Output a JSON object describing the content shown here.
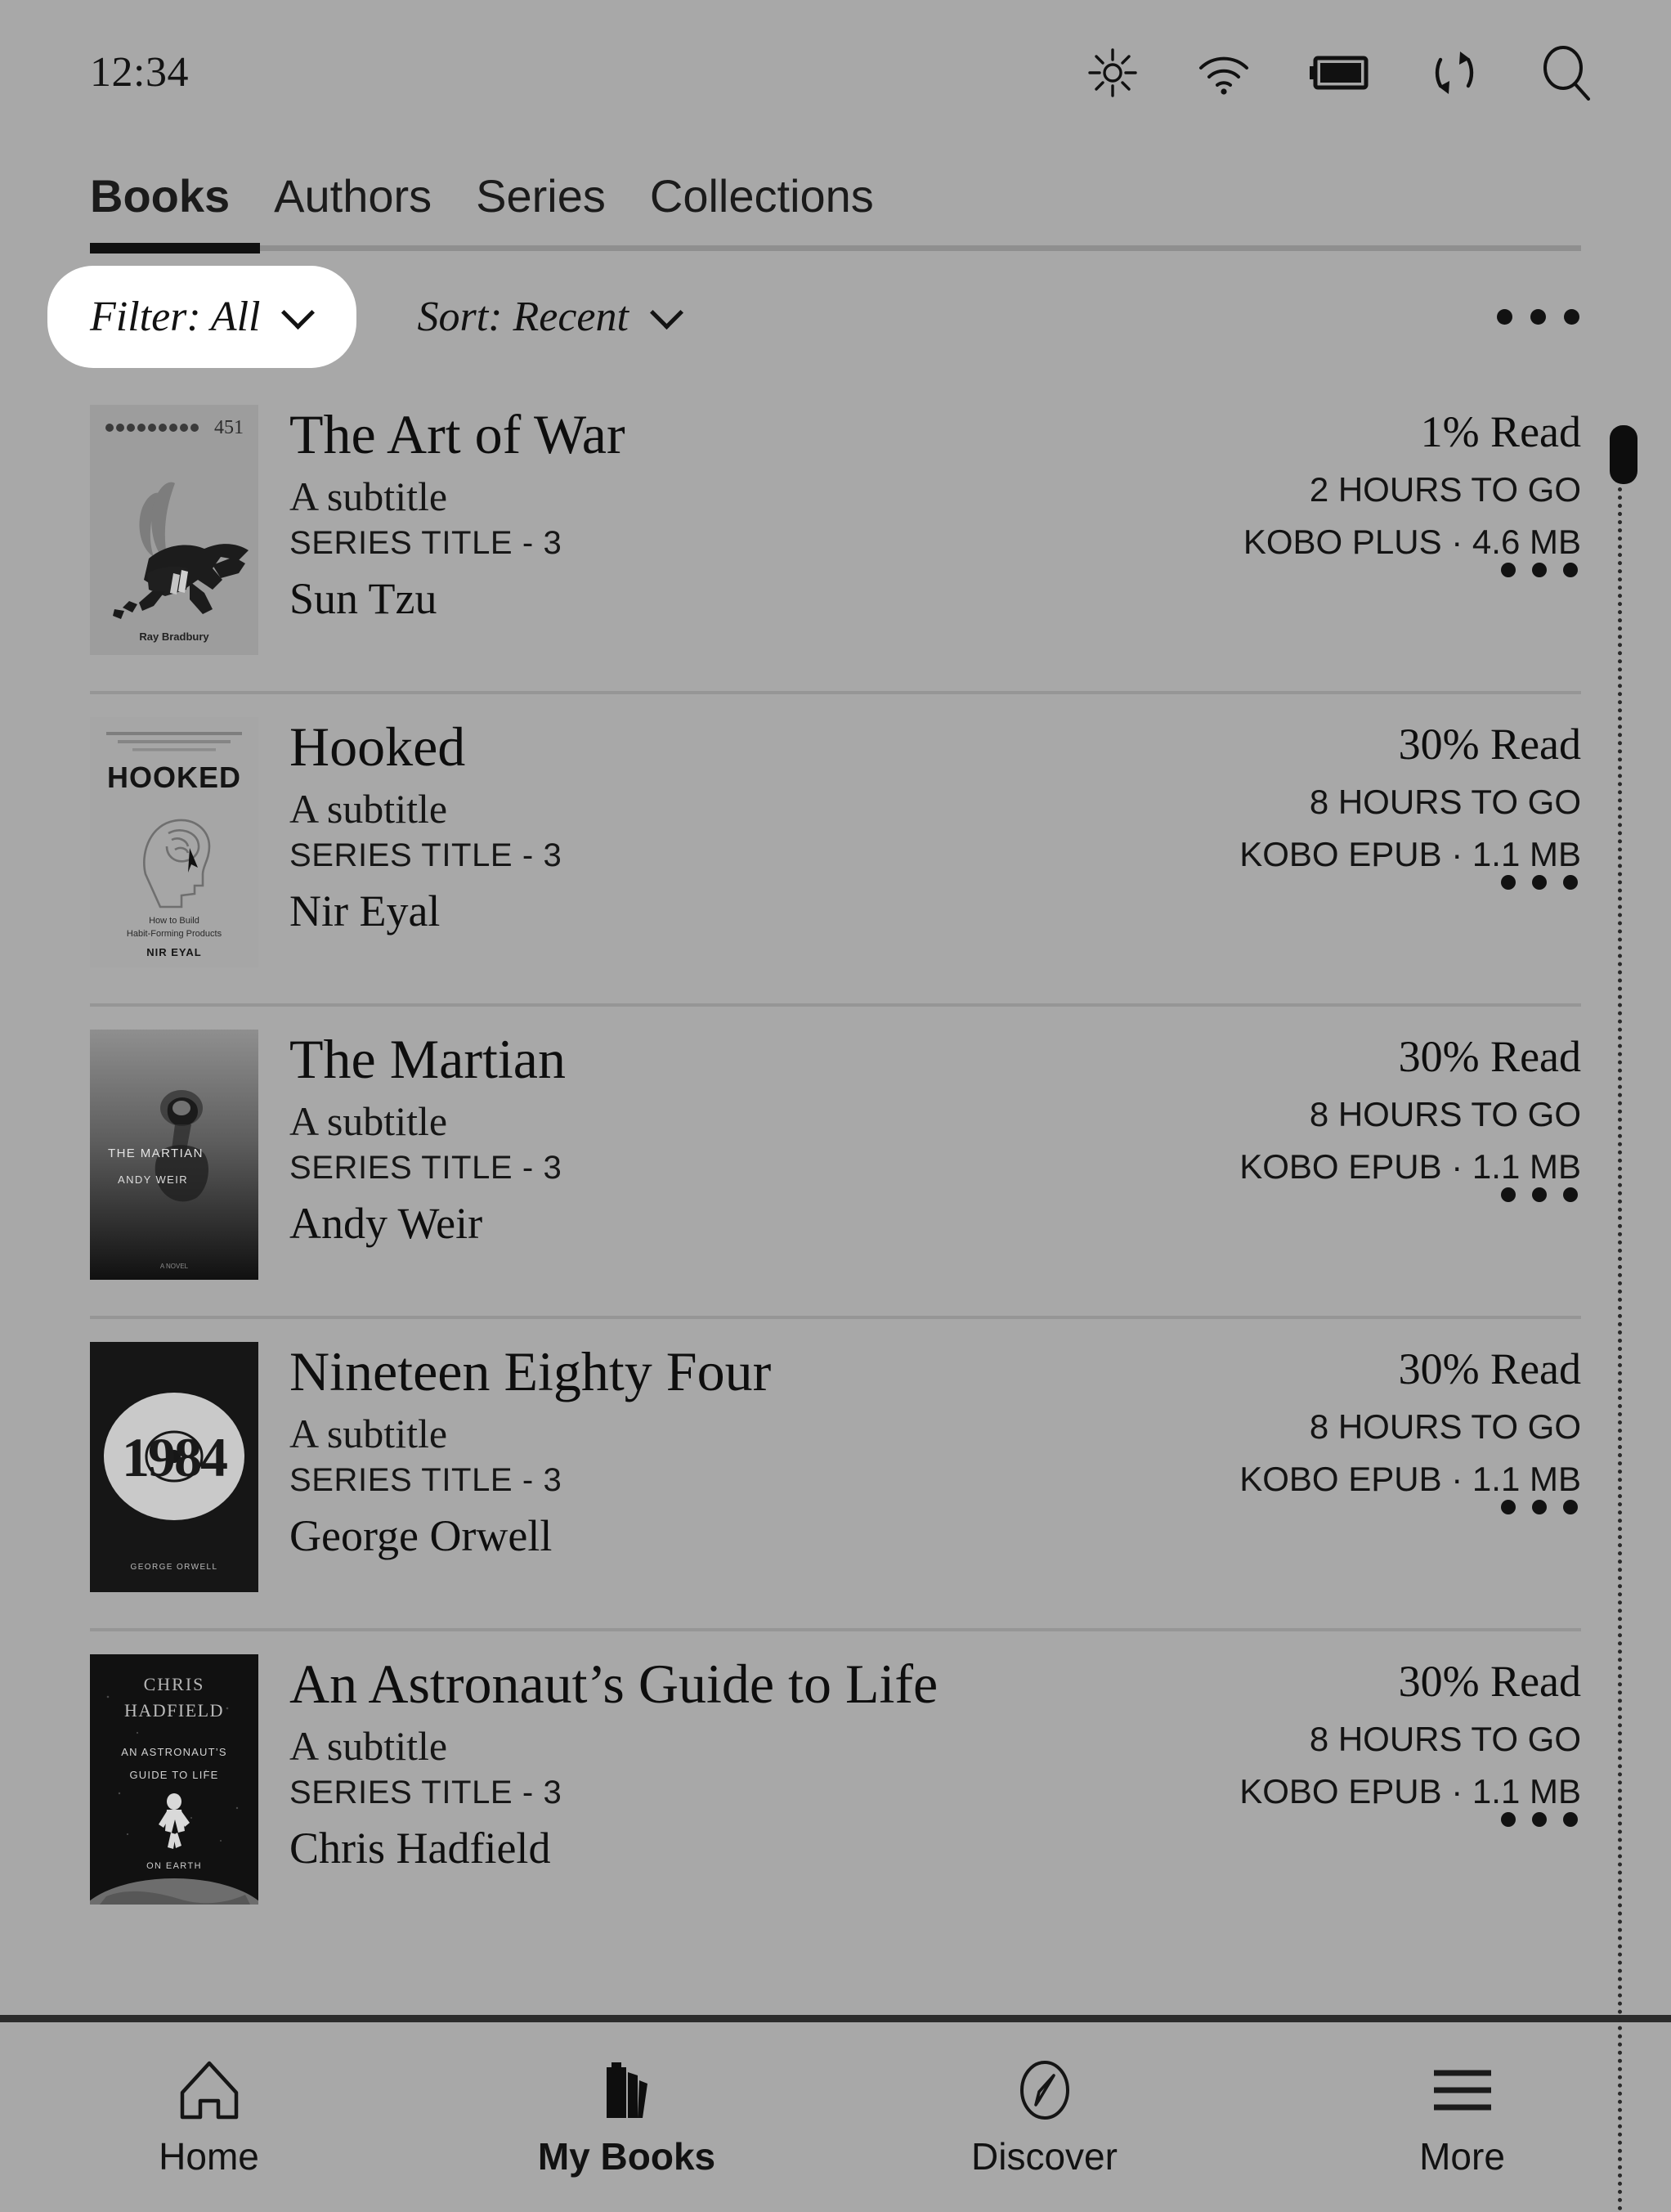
{
  "statusbar": {
    "time": "12:34",
    "icons": [
      "brightness-icon",
      "wifi-icon",
      "battery-icon",
      "sync-icon",
      "search-icon"
    ]
  },
  "tabs": [
    {
      "label": "Books",
      "active": true
    },
    {
      "label": "Authors",
      "active": false
    },
    {
      "label": "Series",
      "active": false
    },
    {
      "label": "Collections",
      "active": false
    }
  ],
  "filterbar": {
    "filter_label": "Filter: All",
    "sort_label": "Sort: Recent",
    "overflow_label": "overflow-menu"
  },
  "books": [
    {
      "title": "The Art of War",
      "subtitle": "A subtitle",
      "series": "SERIES TITLE - 3",
      "author": "Sun Tzu",
      "progress": "1% Read",
      "time_to_go": "2 HOURS TO GO",
      "format": "KOBO PLUS · 4.6 MB",
      "cover": "fahrenheit-451-cover",
      "cover_text": {
        "top": "451",
        "bottom": "Ray Bradbury"
      }
    },
    {
      "title": "Hooked",
      "subtitle": "A subtitle",
      "series": "SERIES TITLE - 3",
      "author": "Nir Eyal",
      "progress": "30% Read",
      "time_to_go": "8 HOURS TO GO",
      "format": "KOBO EPUB · 1.1 MB",
      "cover": "hooked-cover",
      "cover_text": {
        "title": "HOOKED",
        "line1": "How to Build",
        "line2": "Habit-Forming Products",
        "author": "NIR EYAL"
      }
    },
    {
      "title": "The Martian",
      "subtitle": "A subtitle",
      "series": "SERIES TITLE - 3",
      "author": "Andy Weir",
      "progress": "30% Read",
      "time_to_go": "8 HOURS TO GO",
      "format": "KOBO EPUB · 1.1 MB",
      "cover": "the-martian-cover",
      "cover_text": {
        "title": "THE MARTIAN",
        "author": "ANDY WEIR"
      }
    },
    {
      "title": "Nineteen Eighty Four",
      "subtitle": "A subtitle",
      "series": "SERIES TITLE - 3",
      "author": "George Orwell",
      "progress": "30% Read",
      "time_to_go": "8 HOURS TO GO",
      "format": "KOBO EPUB · 1.1 MB",
      "cover": "1984-cover",
      "cover_text": {
        "title": "1984",
        "author": "GEORGE ORWELL"
      }
    },
    {
      "title": "An Astronaut’s Guide to Life",
      "subtitle": "A subtitle",
      "series": "SERIES TITLE - 3",
      "author": "Chris Hadfield",
      "progress": "30% Read",
      "time_to_go": "8 HOURS TO GO",
      "format": "KOBO EPUB · 1.1 MB",
      "cover": "astronauts-guide-cover",
      "cover_text": {
        "author": "CHRIS HADFIELD",
        "line1": "AN ASTRONAUT’S",
        "line2": "GUIDE TO LIFE",
        "line3": "ON EARTH"
      }
    }
  ],
  "bottomnav": [
    {
      "label": "Home",
      "icon": "home-icon",
      "active": false
    },
    {
      "label": "My Books",
      "icon": "books-icon",
      "active": true
    },
    {
      "label": "Discover",
      "icon": "compass-icon",
      "active": false
    },
    {
      "label": "More",
      "icon": "hamburger-icon",
      "active": false
    }
  ],
  "colors": {
    "background": "#a8a8a8",
    "text": "#111111",
    "chip_selected_bg": "#ffffff",
    "divider": "#969696",
    "accent": "#101010"
  }
}
